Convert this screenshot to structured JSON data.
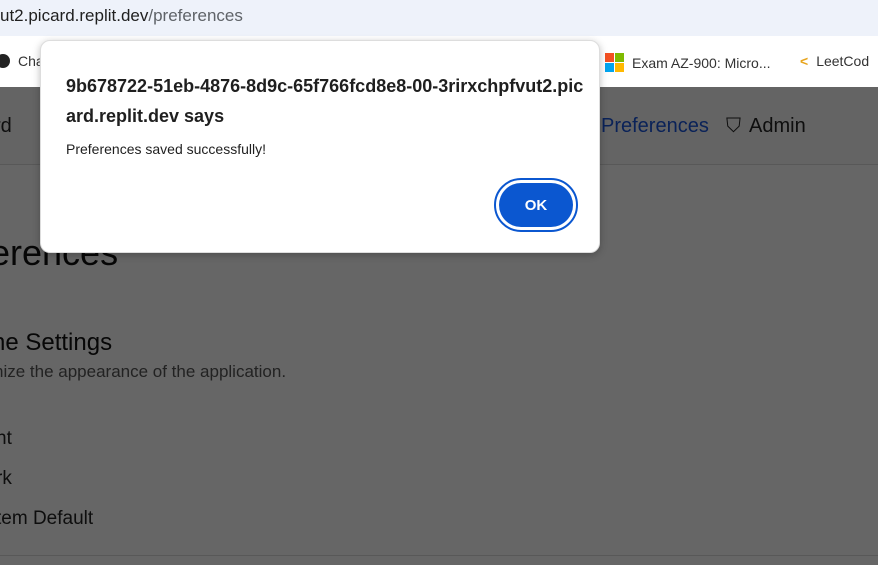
{
  "browser": {
    "url_host": "ut2.picard.replit.dev",
    "url_path": "/preferences",
    "bookmarks": [
      {
        "label": "Cha",
        "icon": "chatgpt-icon"
      },
      {
        "label": "Exam AZ-900: Micro...",
        "icon": "microsoft-icon"
      },
      {
        "label": "LeetCod",
        "icon": "leetcode-icon"
      }
    ]
  },
  "header": {
    "nav": [
      {
        "label": "rd"
      },
      {
        "label": "Preferences",
        "active": true
      },
      {
        "label": "Admin",
        "icon": "shield-icon"
      }
    ]
  },
  "main": {
    "title": "erences",
    "section_title": "ne Settings",
    "section_desc": "nize the appearance of the application.",
    "options": [
      "nt",
      "rk",
      "tem Default"
    ]
  },
  "dialog": {
    "title": "9b678722-51eb-4876-8d9c-65f766fcd8e8-00-3rirxchpfvut2.picard.replit.dev says",
    "message": "Preferences saved successfully!",
    "ok_label": "OK"
  },
  "colors": {
    "accent": "#0b57d0",
    "active_nav": "#1a56db"
  }
}
